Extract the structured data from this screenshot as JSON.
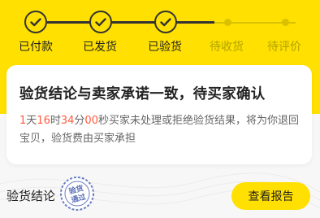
{
  "steps": [
    {
      "label": "已付款",
      "state": "done"
    },
    {
      "label": "已发货",
      "state": "done"
    },
    {
      "label": "已验货",
      "state": "done"
    },
    {
      "label": "待收货",
      "state": "todo"
    },
    {
      "label": "待评价",
      "state": "todo"
    }
  ],
  "card": {
    "title": "验货结论与卖家承诺一致，待买家确认",
    "countdown": {
      "days": "1",
      "days_unit": "天",
      "hours": "16",
      "hours_unit": "时",
      "minutes": "34",
      "minutes_unit": "分",
      "seconds": "00",
      "seconds_unit": "秒"
    },
    "desc_rest": "买家未处理或拒绝验货结果，将为你退回宝贝，验货费由买家承担"
  },
  "bottom": {
    "label": "验货结论",
    "stamp_text_1": "验货",
    "stamp_text_2": "通过",
    "report_button": "查看报告"
  },
  "colors": {
    "brand_yellow": "#FFE000",
    "accent_red": "#ff5a3c",
    "text_dark": "#222222"
  }
}
